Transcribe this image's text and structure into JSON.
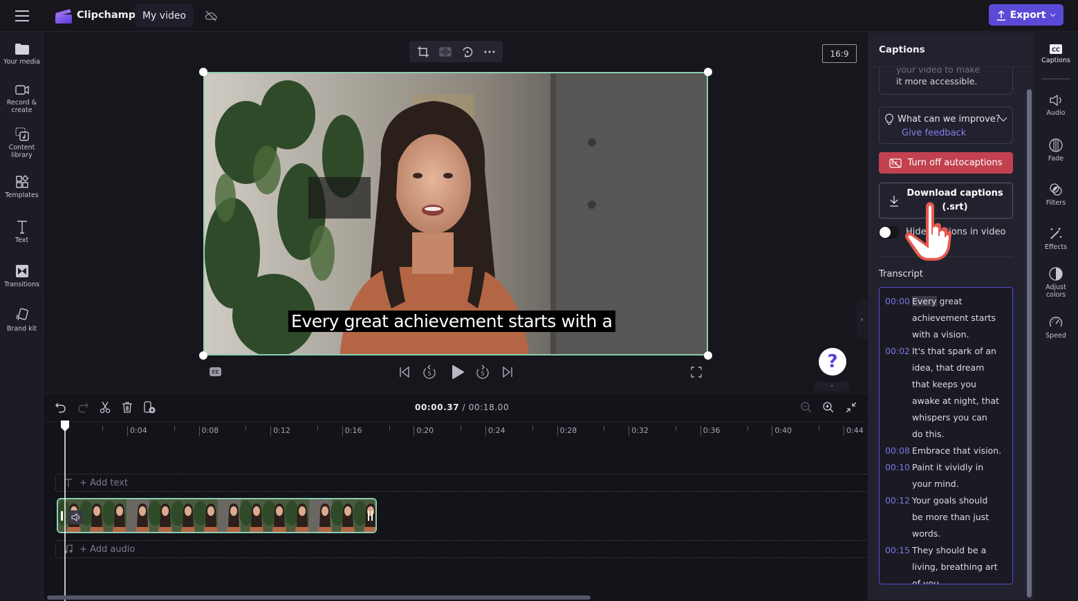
{
  "app": {
    "name": "Clipchamp",
    "project_name": "My video",
    "export_label": "Export",
    "accent": "#5b4ad8"
  },
  "left_rail": {
    "items": [
      {
        "label": "Your media",
        "icon": "folder-icon"
      },
      {
        "label": "Record &",
        "label2": "create",
        "icon": "video-camera-icon"
      },
      {
        "label": "Content",
        "label2": "library",
        "icon": "content-library-icon"
      },
      {
        "label": "Templates",
        "icon": "templates-icon"
      },
      {
        "label": "Text",
        "icon": "text-icon"
      },
      {
        "label": "Transitions",
        "icon": "transitions-icon"
      },
      {
        "label": "Brand kit",
        "icon": "brand-kit-icon"
      }
    ]
  },
  "stage": {
    "aspect_ratio": "16:9",
    "caption_text": "Every great achievement starts with a",
    "cc_label": "CC",
    "help_label": "?"
  },
  "timeline": {
    "current_time": "00:00.37",
    "separator": " / ",
    "total_time": "00:18.00",
    "ticks": [
      "0:04",
      "0:08",
      "0:12",
      "0:16",
      "0:20",
      "0:24",
      "0:28",
      "0:32",
      "0:36",
      "0:40",
      "0:44"
    ],
    "add_text_label": "+ Add text",
    "add_audio_label": "+ Add audio"
  },
  "captions_panel": {
    "title": "Captions",
    "accessibility_text_1": "your video to make",
    "accessibility_text_2": "it more accessible.",
    "feedback_question": "What can we improve?",
    "feedback_link": "Give feedback",
    "turn_off_label": "Turn off autocaptions",
    "download_label_1": "Download captions",
    "download_label_2": "(.srt)",
    "toggle_label": "Hide captions in video",
    "toggle_on": false,
    "transcript_label": "Transcript",
    "transcript": [
      {
        "time": "00:00",
        "lines": [
          "Every great",
          "achievement starts",
          "with a vision."
        ]
      },
      {
        "time": "00:02",
        "lines": [
          "It's that spark of an",
          "idea, that dream",
          "that keeps you",
          "awake at night, that",
          "whispers you can",
          "do this."
        ]
      },
      {
        "time": "00:08",
        "lines": [
          "Embrace that vision."
        ]
      },
      {
        "time": "00:10",
        "lines": [
          "Paint it vividly in",
          "your mind."
        ]
      },
      {
        "time": "00:12",
        "lines": [
          "Your goals should",
          "be more than just",
          "words."
        ]
      },
      {
        "time": "00:15",
        "lines": [
          "They should be a",
          "living, breathing art",
          "of you."
        ]
      }
    ],
    "danger_color": "#c2414f",
    "link_color": "#8a7cf0"
  },
  "right_rail": {
    "items": [
      {
        "label": "Captions",
        "icon": "captions-icon"
      },
      {
        "label": "Audio",
        "icon": "speaker-icon"
      },
      {
        "label": "Fade",
        "icon": "fade-icon"
      },
      {
        "label": "Filters",
        "icon": "filters-icon"
      },
      {
        "label": "Effects",
        "icon": "magic-wand-icon"
      },
      {
        "label": "Adjust",
        "label2": "colors",
        "icon": "adjust-colors-icon"
      },
      {
        "label": "Speed",
        "icon": "speedometer-icon"
      }
    ]
  }
}
